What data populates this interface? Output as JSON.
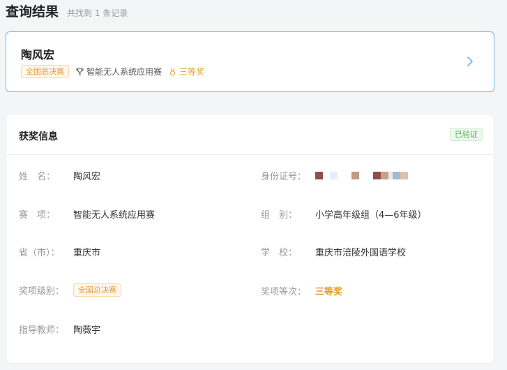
{
  "header": {
    "title": "查询结果",
    "count_text": "共找到 1 条记录"
  },
  "result": {
    "name": "陶风宏",
    "level_tag": "全国总决赛",
    "competition": "智能无人系统应用赛",
    "award": "三等奖"
  },
  "info": {
    "title": "获奖信息",
    "verified": "已验证",
    "fields": {
      "name_label": "姓　名：",
      "name_value": "陶风宏",
      "id_label": "身份证号：",
      "item_label": "赛　项：",
      "item_value": "智能无人系统应用赛",
      "group_label": "组　别：",
      "group_value": "小学高年级组（4—6年级）",
      "province_label": "省（市）：",
      "province_value": "重庆市",
      "school_label": "学　校：",
      "school_value": "重庆市涪陵外国语学校",
      "level_label": "奖项级别：",
      "level_value": "全国总决赛",
      "rank_label": "奖项等次：",
      "rank_value": "三等奖",
      "teacher_label": "指导教师：",
      "teacher_value": "陶薇宇"
    }
  },
  "colors": {
    "accent": "#6fb6e6",
    "award": "#e39a2c",
    "verified": "#52b058"
  },
  "icons": {
    "competition": "trophy-icon",
    "award": "medal-icon",
    "open": "chevron-right-icon"
  }
}
